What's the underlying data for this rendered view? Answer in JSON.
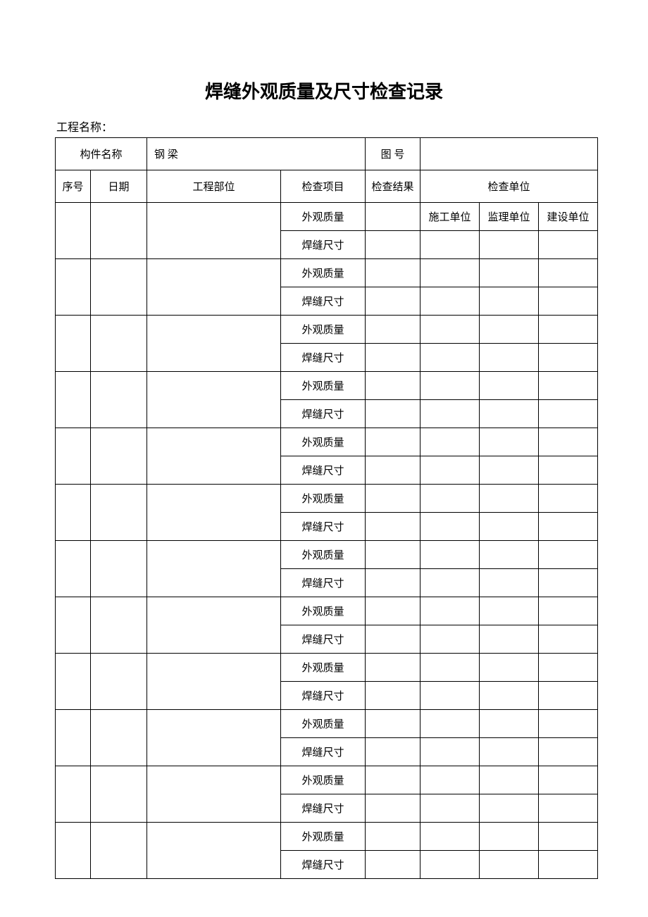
{
  "title": "焊缝外观质量及尺寸检查记录",
  "project_name_label": "工程名称：",
  "header": {
    "component_name_label": "构件名称",
    "component_name_value": "钢 梁",
    "drawing_no_label": "图 号",
    "drawing_no_value": ""
  },
  "columns": {
    "seq": "序号",
    "date": "日期",
    "position": "工程部位",
    "check_item": "检查项目",
    "check_result": "检查结果",
    "check_unit": "检查单位",
    "unit_construction": "施工单位",
    "unit_supervision": "监理单位",
    "unit_owner": "建设单位"
  },
  "check_items": {
    "appearance": "外观质量",
    "dimension": "焊缝尺寸"
  },
  "group_count": 12
}
